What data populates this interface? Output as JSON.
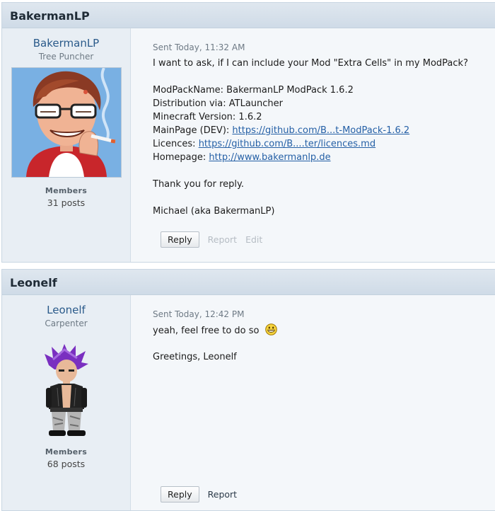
{
  "posts": [
    {
      "header_name": "BakermanLP",
      "author": {
        "name": "BakermanLP",
        "rank": "Tree Puncher",
        "group": "Members",
        "posts": "31 posts"
      },
      "sent": "Sent Today, 11:32 AM",
      "body": {
        "line1": "I want to ask, if I can include your Mod \"Extra Cells\" in my ModPack?",
        "modpack_name": "ModPackName: BakermanLP ModPack 1.6.2",
        "distribution": "Distribution via: ATLauncher",
        "mc_version": "Minecraft Version: 1.6.2",
        "mainpage_label": "MainPage (DEV):",
        "mainpage_link": "https://github.com/B...t-ModPack-1.6.2",
        "licences_label": "Licences:",
        "licences_link": "https://github.com/B....ter/licences.md",
        "homepage_label": "Homepage:",
        "homepage_link": "http://www.bakermanlp.de",
        "thanks": "Thank you for reply.",
        "signoff": "Michael (aka BakermanLP)"
      },
      "actions": {
        "reply": "Reply",
        "report": "Report",
        "edit": "Edit"
      }
    },
    {
      "header_name": "Leonelf",
      "author": {
        "name": "Leonelf",
        "rank": "Carpenter",
        "group": "Members",
        "posts": "68 posts"
      },
      "sent": "Sent Today, 12:42 PM",
      "body": {
        "line1": "yeah, feel free to do so",
        "greeting": "Greetings, Leonelf"
      },
      "actions": {
        "reply": "Reply",
        "report": "Report"
      }
    }
  ]
}
